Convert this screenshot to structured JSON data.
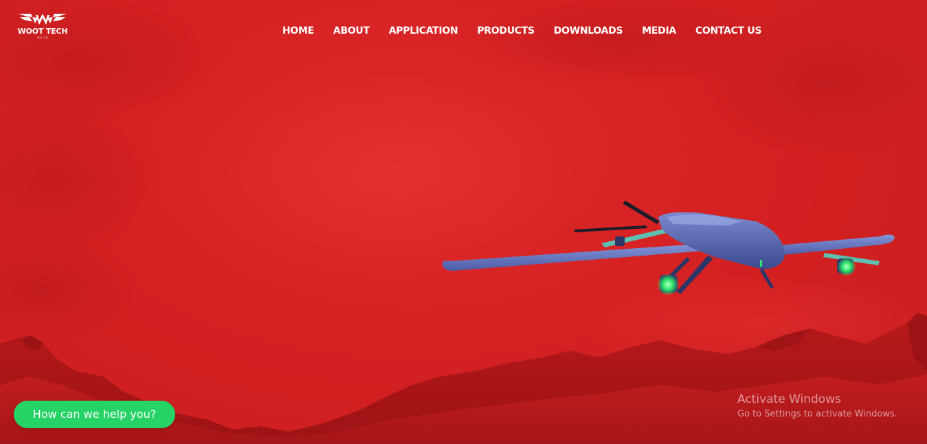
{
  "logo": {
    "name": "WOOT TECH",
    "sub": "PVT LTD",
    "icon": "winged-w-logo-icon"
  },
  "nav": {
    "items": [
      {
        "label": "HOME"
      },
      {
        "label": "ABOUT"
      },
      {
        "label": "APPLICATION"
      },
      {
        "label": "PRODUCTS"
      },
      {
        "label": "DOWNLOADS"
      },
      {
        "label": "MEDIA"
      },
      {
        "label": "CONTACT US"
      }
    ]
  },
  "hero": {
    "background_color": "#d42021",
    "image": "vtol-fixed-wing-drone-icon"
  },
  "help_widget": {
    "label": "How can we help you?",
    "color": "#25d366"
  },
  "os_watermark": {
    "title": "Activate Windows",
    "subtitle": "Go to Settings to activate Windows."
  }
}
